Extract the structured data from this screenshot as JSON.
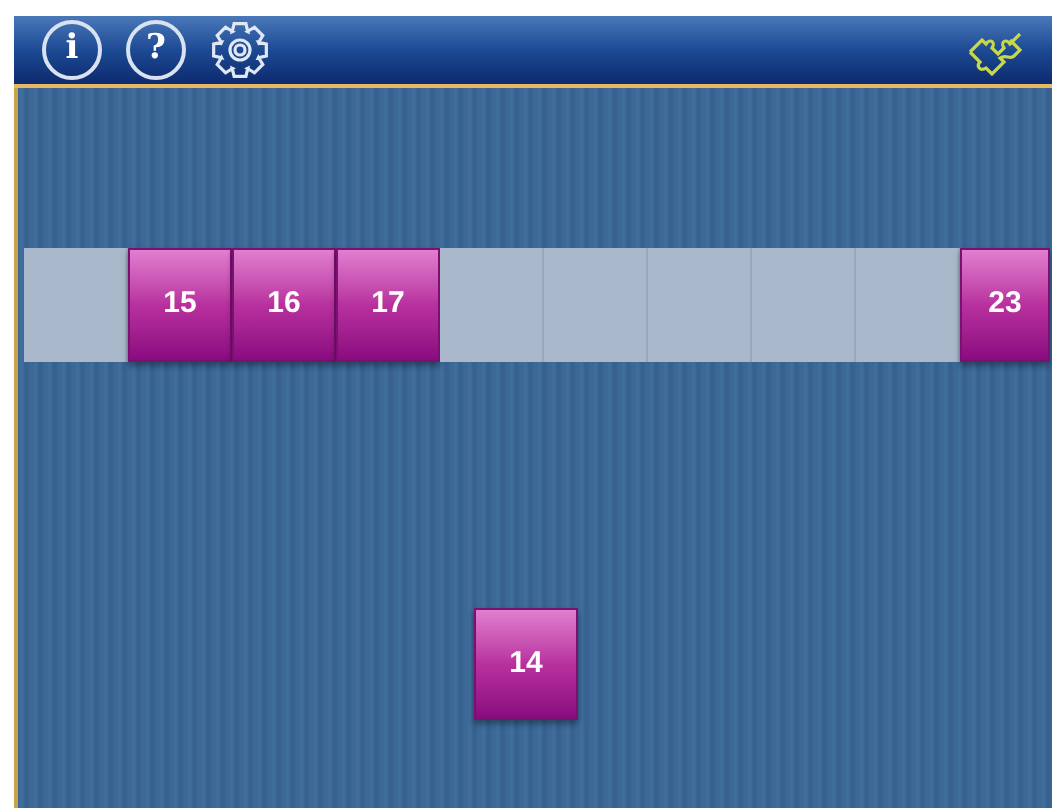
{
  "toolbar": {
    "buttons": [
      {
        "kind": "info",
        "label": "i"
      },
      {
        "kind": "help",
        "label": "?"
      },
      {
        "kind": "settings"
      }
    ],
    "puzzle": {
      "kind": "puzzle"
    }
  },
  "slots": [
    {
      "kind": "empty"
    },
    {
      "kind": "tile",
      "tile": "15"
    },
    {
      "kind": "tile",
      "tile": "16"
    },
    {
      "kind": "tile",
      "tile": "17"
    },
    {
      "kind": "empty"
    },
    {
      "kind": "empty"
    },
    {
      "kind": "empty"
    },
    {
      "kind": "empty"
    },
    {
      "kind": "empty"
    },
    {
      "kind": "tile",
      "tile": "23"
    }
  ],
  "loose_tiles": [
    {
      "label": "14"
    }
  ]
}
